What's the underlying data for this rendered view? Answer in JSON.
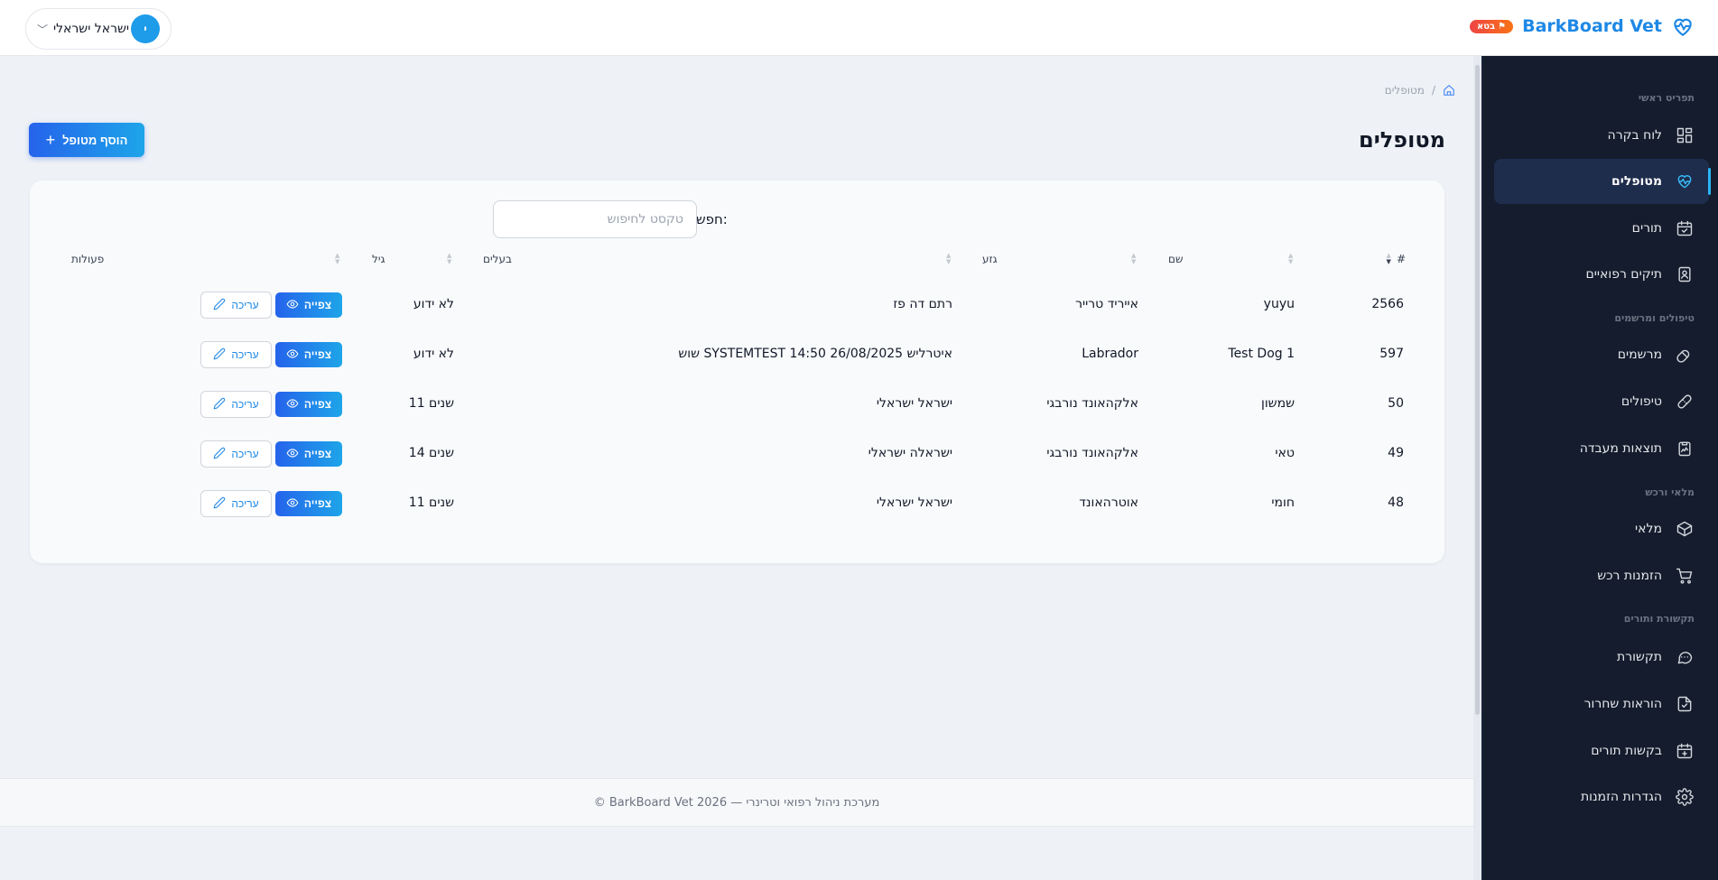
{
  "header": {
    "brand_name": "BarkBoard Vet",
    "beta_label": "בטא",
    "user_name": "ישראל ישראלי",
    "user_initial": "י"
  },
  "sidebar": {
    "sections": [
      "תפריט ראשי",
      "טיפולים ומרשמים",
      "מלאי ורכש",
      "תקשורת ותורים"
    ],
    "items": [
      {
        "label": "לוח בקרה",
        "icon": "dashboard-icon",
        "active": false
      },
      {
        "label": "מטופלים",
        "icon": "heart-pulse-icon",
        "active": true
      },
      {
        "label": "תורים",
        "icon": "calendar-check-icon",
        "active": false
      },
      {
        "label": "תיקים רפואיים",
        "icon": "medical-record-icon",
        "active": false
      },
      {
        "label": "מרשמים",
        "icon": "pill-icon",
        "active": false
      },
      {
        "label": "טיפולים",
        "icon": "bandage-icon",
        "active": false
      },
      {
        "label": "תוצאות מעבדה",
        "icon": "clipboard-chart-icon",
        "active": false
      },
      {
        "label": "מלאי",
        "icon": "box-icon",
        "active": false
      },
      {
        "label": "הזמנות רכש",
        "icon": "cart-icon",
        "active": false
      },
      {
        "label": "תקשורת",
        "icon": "chat-icon",
        "active": false
      },
      {
        "label": "הוראות שחרור",
        "icon": "discharge-doc-icon",
        "active": false
      },
      {
        "label": "בקשות תורים",
        "icon": "calendar-plus-icon",
        "active": false
      },
      {
        "label": "הגדרות הזמנות",
        "icon": "gear-icon",
        "active": false
      }
    ]
  },
  "breadcrumb": {
    "current": "מטופלים"
  },
  "page": {
    "title": "מטופלים",
    "add_button": "הוסף מטופל",
    "search_label": "חפש:",
    "search_placeholder": "טקסט לחיפוש"
  },
  "table": {
    "columns": [
      "#",
      "שם",
      "גזע",
      "בעלים",
      "גיל",
      "פעולות"
    ],
    "view_label": "צפייה",
    "edit_label": "עריכה",
    "rows": [
      {
        "id": "2566",
        "name": "yuyu",
        "breed": "אייריד טרייר",
        "owner": "רתם דה פז",
        "age": "לא ידוע"
      },
      {
        "id": "597",
        "name": "Test Dog 1",
        "breed": "Labrador",
        "owner": "שוש SYSTEMTEST איטרליש 26/08/2025 14:50",
        "age": "לא ידוע"
      },
      {
        "id": "50",
        "name": "שמשון",
        "breed": "אלקהאונד נורבגי",
        "owner": "ישראל ישראלי",
        "age": "11 שנים"
      },
      {
        "id": "49",
        "name": "טאי",
        "breed": "אלקהאונד נורבגי",
        "owner": "ישראלה ישראלי",
        "age": "14 שנים"
      },
      {
        "id": "48",
        "name": "חומי",
        "breed": "אוטרהאונד",
        "owner": "ישראל ישראלי",
        "age": "11 שנים"
      }
    ]
  },
  "footer": {
    "text": "© BarkBoard Vet 2026 — מערכת ניהול רפואי וטרינרי"
  },
  "colors": {
    "brand": "#1e88e5",
    "sidebar_bg": "#141c2d",
    "active_item_bg": "#1f2d4d",
    "accent": "#29b6f6"
  }
}
